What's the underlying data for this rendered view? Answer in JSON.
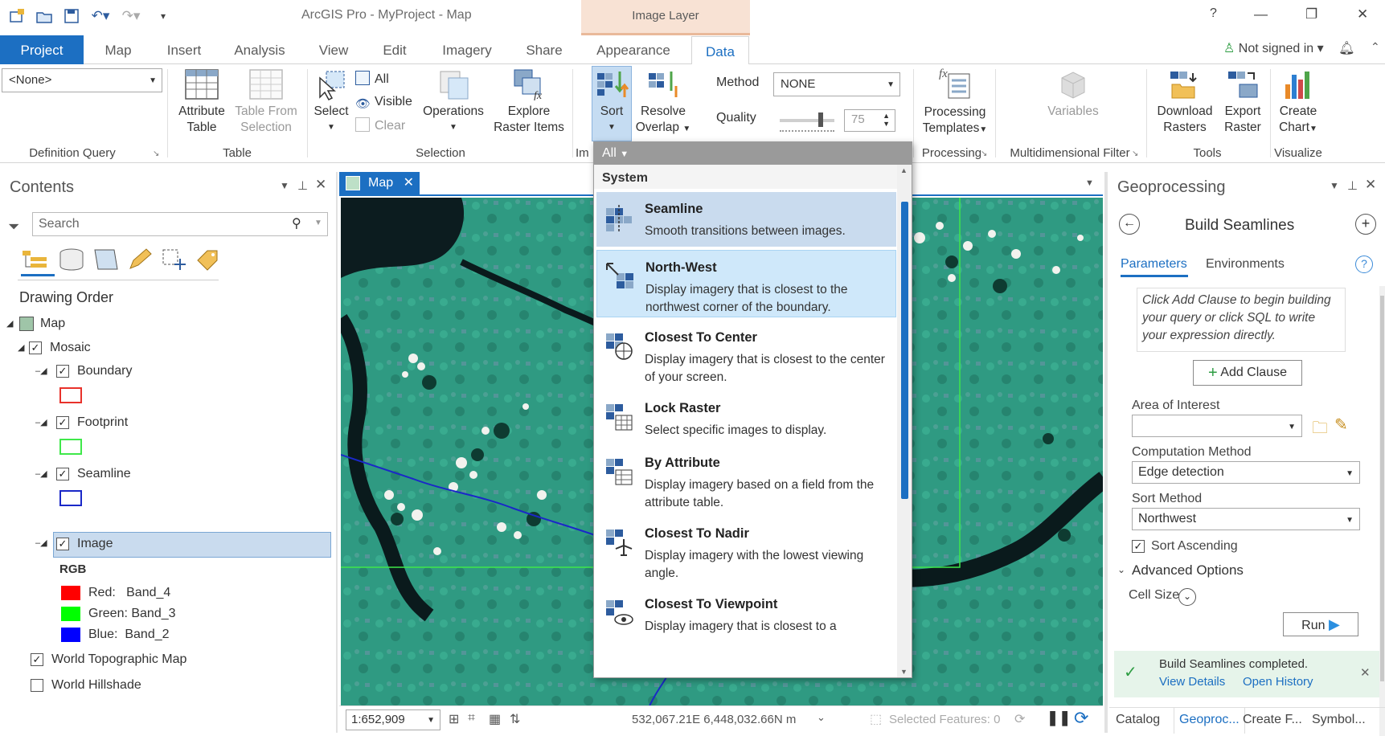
{
  "app": {
    "title": "ArcGIS Pro - MyProject - Map",
    "context_tab_group": "Image Layer"
  },
  "window": {
    "help": "?",
    "signin": "Not signed in"
  },
  "tabs": [
    "Project",
    "Map",
    "Insert",
    "Analysis",
    "View",
    "Edit",
    "Imagery",
    "Share",
    "Appearance",
    "Data"
  ],
  "ribbon": {
    "definition_query": {
      "value": "<None>",
      "group_label": "Definition Query"
    },
    "table": {
      "attribute_table_line1": "Attribute",
      "attribute_table_line2": "Table",
      "table_from_selection_line1": "Table From",
      "table_from_selection_line2": "Selection",
      "group_label": "Table"
    },
    "selection": {
      "select": "Select",
      "all": "All",
      "visible": "Visible",
      "clear": "Clear",
      "operations": "Operations",
      "explore_line1": "Explore",
      "explore_line2": "Raster Items",
      "group_label": "Selection"
    },
    "mosaic": {
      "sort": "Sort",
      "resolve_line1": "Resolve",
      "resolve_line2": "Overlap",
      "method_label": "Method",
      "method_value": "NONE",
      "quality_label": "Quality",
      "quality_value": "75",
      "group_label_cut": "Im"
    },
    "processing": {
      "templates_line1": "Processing",
      "templates_line2": "Templates",
      "group_label": "Processing"
    },
    "multidim": {
      "variables": "Variables",
      "group_label": "Multidimensional Filter"
    },
    "tools": {
      "download_line1": "Download",
      "download_line2": "Rasters",
      "export_line1": "Export",
      "export_line2": "Raster",
      "group_label": "Tools"
    },
    "visualize": {
      "create_chart_line1": "Create",
      "create_chart_line2": "Chart",
      "group_label": "Visualize"
    }
  },
  "contents": {
    "title": "Contents",
    "search_placeholder": "Search",
    "drawing_order": "Drawing Order",
    "layers": {
      "map": "Map",
      "mosaic": "Mosaic",
      "boundary": "Boundary",
      "footprint": "Footprint",
      "seamline": "Seamline",
      "image": "Image",
      "rgb": "RGB",
      "red": "Red:   Band_4",
      "green": "Green: Band_3",
      "blue": "Blue:  Band_2",
      "topo": "World Topographic Map",
      "hillshade": "World Hillshade"
    },
    "colors": {
      "boundary": "#e8322b",
      "footprint": "#3fe84a",
      "seamline": "#1a28c8",
      "red": "#ff0000",
      "green": "#00ff00",
      "blue": "#0000ff"
    }
  },
  "map": {
    "tab_label": "Map",
    "scale": "1:652,909",
    "coords": "532,067.21E 6,448,032.66N m",
    "selected_features": "Selected Features: 0"
  },
  "sort_dropdown": {
    "filter": "All",
    "section": "System",
    "items": [
      {
        "title": "Seamline",
        "desc": "Smooth transitions between images."
      },
      {
        "title": "North-West",
        "desc": "Display imagery that is closest to the northwest corner of the boundary."
      },
      {
        "title": "Closest To Center",
        "desc": "Display imagery that is closest to the center of your screen."
      },
      {
        "title": "Lock Raster",
        "desc": "Select specific images to display."
      },
      {
        "title": "By Attribute",
        "desc": "Display imagery based on a field from the attribute table."
      },
      {
        "title": "Closest To Nadir",
        "desc": "Display imagery with the lowest viewing angle."
      },
      {
        "title": "Closest To Viewpoint",
        "desc": "Display imagery that is closest to a"
      }
    ]
  },
  "geoprocessing": {
    "title": "Geoprocessing",
    "tool": "Build Seamlines",
    "tab_parameters": "Parameters",
    "tab_environments": "Environments",
    "query_hint": "Click Add Clause to begin building your query or click SQL to write your expression directly.",
    "add_clause": "Add Clause",
    "area_of_interest": "Area of Interest",
    "computation_method_label": "Computation Method",
    "computation_method_value": "Edge detection",
    "sort_method_label": "Sort Method",
    "sort_method_value": "Northwest",
    "sort_ascending": "Sort Ascending",
    "advanced_options": "Advanced Options",
    "cell_size": "Cell Size",
    "run": "Run",
    "status": "Build Seamlines completed.",
    "view_details": "View Details",
    "open_history": "Open History"
  },
  "bottom_tabs": [
    "Catalog",
    "Geoproc...",
    "Create F...",
    "Symbol..."
  ]
}
